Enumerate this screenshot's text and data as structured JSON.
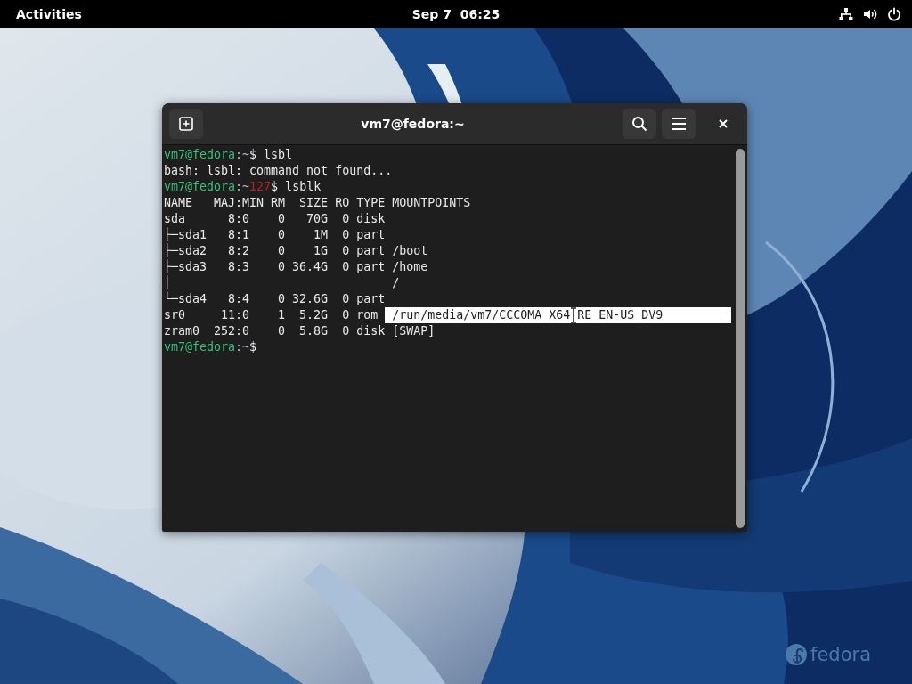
{
  "top_bar": {
    "activities": "Activities",
    "clock": "Sep 7  06:25"
  },
  "window": {
    "title": "vm7@fedora:~"
  },
  "terminal": {
    "lines": [
      {
        "kind": "prompt",
        "user": "vm7@fedora",
        "dir": ":~",
        "prompt_end": "$ ",
        "command": "lsbl"
      },
      {
        "kind": "output",
        "text": "bash: lsbl: command not found..."
      },
      {
        "kind": "prompt",
        "user": "vm7@fedora",
        "dir": ":~",
        "status": "127",
        "prompt_end": "$ ",
        "command": "lsblk"
      },
      {
        "kind": "output",
        "text": "NAME   MAJ:MIN RM  SIZE RO TYPE MOUNTPOINTS"
      },
      {
        "kind": "output",
        "text": "sda      8:0    0   70G  0 disk"
      },
      {
        "kind": "output",
        "text": "├─sda1   8:1    0    1M  0 part"
      },
      {
        "kind": "output",
        "text": "├─sda2   8:2    0    1G  0 part /boot"
      },
      {
        "kind": "output",
        "text": "├─sda3   8:3    0 36.4G  0 part /home"
      },
      {
        "kind": "output",
        "text": "│                               /"
      },
      {
        "kind": "output",
        "text": "└─sda4   8:4    0 32.6G  0 part"
      },
      {
        "kind": "output",
        "text": "sr0     11:0    1  5.2G  0 rom",
        "selection": "/run/media/vm7/CCCOMA_X64",
        "selection_after_cursor": "RE_EN-US_DV9"
      },
      {
        "kind": "output",
        "text": "zram0  252:0    0  5.8G  0 disk [SWAP]"
      },
      {
        "kind": "prompt",
        "user": "vm7@fedora",
        "dir": ":~",
        "prompt_end": "$"
      }
    ]
  },
  "desktop": {
    "logo": "fedora"
  }
}
